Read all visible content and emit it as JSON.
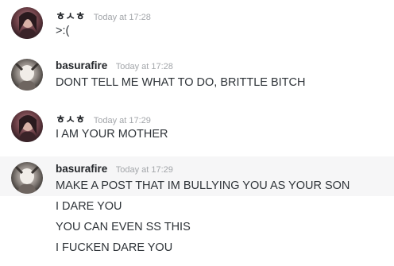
{
  "messages": [
    {
      "username": "ㅎㅅㅎ",
      "timestamp": "Today at 17:28",
      "lines": [
        ">:("
      ]
    },
    {
      "username": "basurafire",
      "timestamp": "Today at 17:28",
      "lines": [
        "DONT TELL ME WHAT TO DO, BRITTLE BITCH"
      ]
    },
    {
      "username": "ㅎㅅㅎ",
      "timestamp": "Today at 17:29",
      "lines": [
        "I AM YOUR MOTHER"
      ]
    },
    {
      "username": "basurafire",
      "timestamp": "Today at 17:29",
      "lines": [
        "MAKE A POST THAT IM BULLYING YOU AS YOUR SON",
        "I DARE YOU",
        "YOU CAN EVEN SS THIS",
        "I FUCKEN DARE YOU"
      ]
    }
  ]
}
